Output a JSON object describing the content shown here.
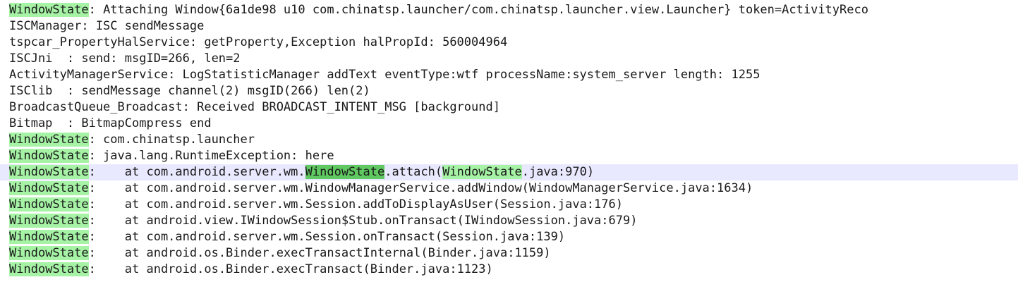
{
  "highlight_term": "WindowState",
  "colors": {
    "match_highlight": "#a6f3a6",
    "selected_match_highlight": "#60c860",
    "current_line_background": "#e8e8ff"
  },
  "lines": [
    {
      "gutter": "",
      "parts": [
        {
          "t": "WindowState",
          "h": 1
        },
        {
          "t": ": Attaching Window{6a1de98 u10 com.chinatsp.launcher/com.chinatsp.launcher.view.Launcher} token=ActivityReco"
        }
      ]
    },
    {
      "gutter": "",
      "parts": [
        {
          "t": "ISCManager: ISC sendMessage"
        }
      ]
    },
    {
      "gutter": "",
      "parts": [
        {
          "t": "tspcar_PropertyHalService: getProperty,Exception halPropId: 560004964"
        }
      ]
    },
    {
      "gutter": "",
      "parts": [
        {
          "t": "ISCJni  : send: msgID=266, len=2"
        }
      ]
    },
    {
      "gutter": "",
      "parts": [
        {
          "t": "ActivityManagerService: LogStatisticManager addText eventType:wtf processName:system_server length: 1255"
        }
      ]
    },
    {
      "gutter": "",
      "parts": [
        {
          "t": "ISClib  : sendMessage channel(2) msgID(266) len(2)"
        }
      ]
    },
    {
      "gutter": "",
      "parts": [
        {
          "t": "BroadcastQueue_Broadcast: Received BROADCAST_INTENT_MSG [background]"
        }
      ]
    },
    {
      "gutter": "",
      "parts": [
        {
          "t": "Bitmap  : BitmapCompress end"
        }
      ]
    },
    {
      "gutter": "",
      "parts": [
        {
          "t": "WindowState",
          "h": 1
        },
        {
          "t": ": com.chinatsp.launcher"
        }
      ]
    },
    {
      "gutter": "",
      "parts": [
        {
          "t": "WindowState",
          "h": 1
        },
        {
          "t": ": java.lang.RuntimeException: here"
        }
      ]
    },
    {
      "gutter": "",
      "current": true,
      "parts": [
        {
          "t": "WindowState",
          "h": 1
        },
        {
          "t": ":    at com.android.server.wm."
        },
        {
          "t": "WindowState",
          "h": 2
        },
        {
          "t": ".attach("
        },
        {
          "t": "WindowState",
          "h": 1
        },
        {
          "t": ".java:970)"
        }
      ]
    },
    {
      "gutter": "",
      "parts": [
        {
          "t": "WindowState",
          "h": 1
        },
        {
          "t": ":    at com.android.server.wm.WindowManagerService.addWindow(WindowManagerService.java:1634)"
        }
      ]
    },
    {
      "gutter": "",
      "parts": [
        {
          "t": "WindowState",
          "h": 1
        },
        {
          "t": ":    at com.android.server.wm.Session.addToDisplayAsUser(Session.java:176)"
        }
      ]
    },
    {
      "gutter": "",
      "parts": [
        {
          "t": "WindowState",
          "h": 1
        },
        {
          "t": ":    at android.view.IWindowSession$Stub.onTransact(IWindowSession.java:679)"
        }
      ]
    },
    {
      "gutter": "",
      "parts": [
        {
          "t": "WindowState",
          "h": 1
        },
        {
          "t": ":    at com.android.server.wm.Session.onTransact(Session.java:139)"
        }
      ]
    },
    {
      "gutter": "",
      "parts": [
        {
          "t": "WindowState",
          "h": 1
        },
        {
          "t": ":    at android.os.Binder.execTransactInternal(Binder.java:1159)"
        }
      ]
    },
    {
      "gutter": "",
      "parts": [
        {
          "t": "WindowState",
          "h": 1
        },
        {
          "t": ":    at android.os.Binder.execTransact(Binder.java:1123)"
        }
      ]
    }
  ]
}
